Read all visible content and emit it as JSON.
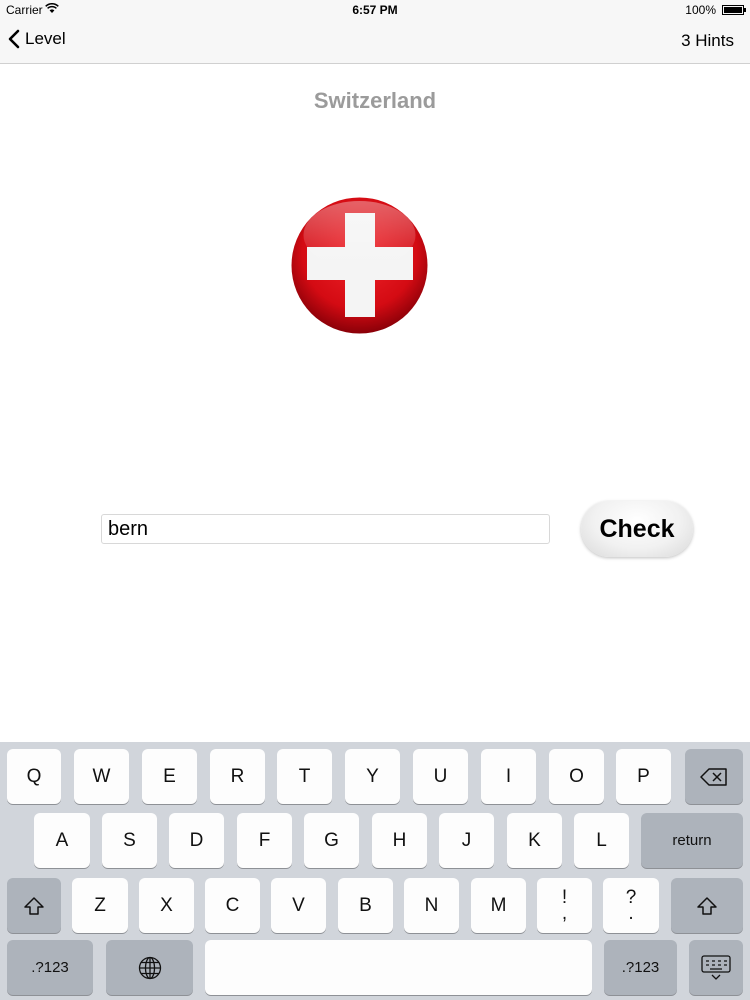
{
  "status": {
    "carrier": "Carrier",
    "time": "6:57 PM",
    "battery": "100%"
  },
  "nav": {
    "back_label": "Level",
    "hints_label": "3 Hints"
  },
  "country": "Switzerland",
  "answer": {
    "value": "bern",
    "placeholder": ""
  },
  "check_label": "Check",
  "colors": {
    "flag_red": "#d40b13",
    "title_gray": "#9b9b9b",
    "keyboard_bg": "#d1d5db"
  },
  "keyboard": {
    "row1": [
      "Q",
      "W",
      "E",
      "R",
      "T",
      "Y",
      "U",
      "I",
      "O",
      "P"
    ],
    "row2": [
      "A",
      "S",
      "D",
      "F",
      "G",
      "H",
      "J",
      "K",
      "L"
    ],
    "row3": [
      "Z",
      "X",
      "C",
      "V",
      "B",
      "N",
      "M"
    ],
    "punct1": {
      "top": "!",
      "bottom": ","
    },
    "punct2": {
      "top": "?",
      "bottom": "."
    },
    "return_label": "return",
    "numbers_left": ".?123",
    "numbers_right": ".?123",
    "icons": {
      "delete": "backspace-icon",
      "shift": "shift-icon",
      "globe": "globe-icon",
      "dismiss": "keyboard-dismiss-icon"
    }
  }
}
